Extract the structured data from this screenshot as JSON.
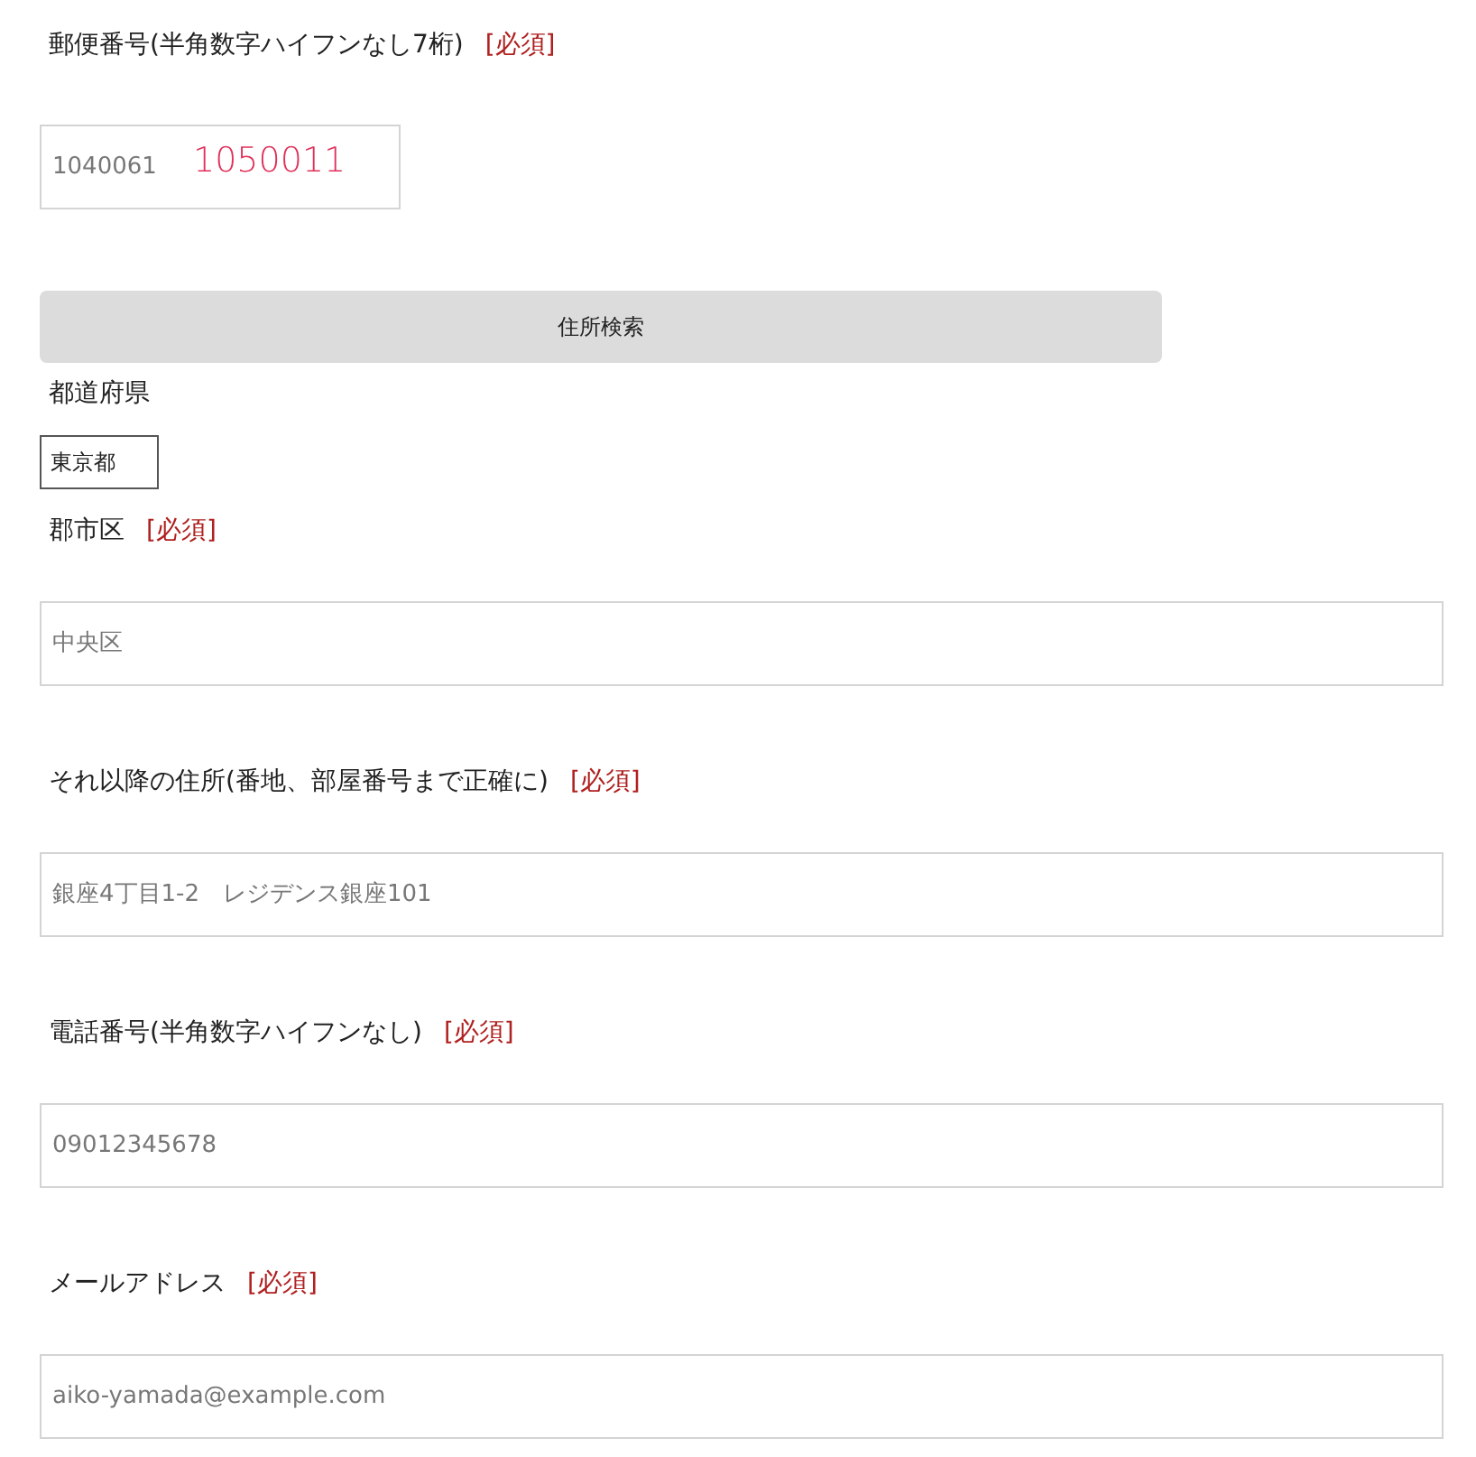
{
  "fields": [
    {
      "kind": "short",
      "label": "郵便番号(半角数字ハイフンなし7桁)",
      "required": "[必須]",
      "placeholder": "1040061",
      "annotation": "1050011"
    },
    {
      "kind": "button",
      "label": "住所検索"
    },
    {
      "kind": "select",
      "label": "都道府県",
      "value": "東京都"
    },
    {
      "kind": "text",
      "label": "郡市区",
      "required": "[必須]",
      "placeholder": "中央区"
    },
    {
      "kind": "text",
      "label": "それ以降の住所(番地、部屋番号まで正確に)",
      "required": "[必須]",
      "placeholder": "銀座4丁目1-2　レジデンス銀座101"
    },
    {
      "kind": "text",
      "label": "電話番号(半角数字ハイフンなし)",
      "required": "[必須]",
      "placeholder": "09012345678"
    },
    {
      "kind": "text",
      "label": "メールアドレス",
      "required": "[必須]",
      "placeholder": "aiko-yamada@example.com"
    }
  ]
}
